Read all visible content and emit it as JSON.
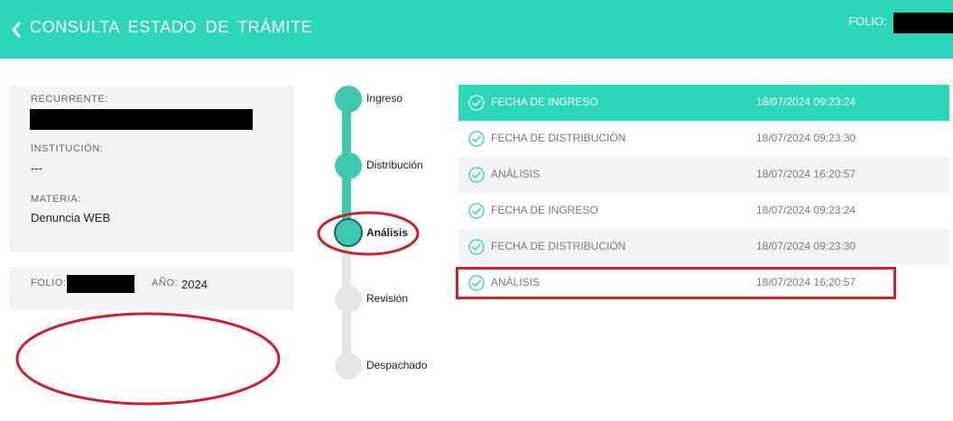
{
  "header": {
    "title": "CONSULTA ESTADO DE TRÁMITE",
    "folio_label": "FOLIO:",
    "bg_color": "#2bd6b9"
  },
  "info": {
    "recurrente_label": "RECURRENTE:",
    "institucion_label": "INSTITUCIÓN:",
    "institucion_value": "---",
    "materia_label": "MATERIA:",
    "materia_value": "Denuncia WEB"
  },
  "folio_card": {
    "folio_label": "FOLIO:",
    "anio_label": "AÑO:",
    "anio_value": "2024"
  },
  "timeline": {
    "stages": [
      {
        "label": "Ingreso",
        "state": "done"
      },
      {
        "label": "Distribución",
        "state": "done"
      },
      {
        "label": "Análisis",
        "state": "current"
      },
      {
        "label": "Revisión",
        "state": "pending"
      },
      {
        "label": "Despachado",
        "state": "pending"
      }
    ],
    "colors": {
      "done": "#3ec9ae",
      "pending": "#e6e6e6",
      "current_border": "#1e5f73"
    }
  },
  "history": {
    "rows": [
      {
        "label": "FECHA DE INGRESO",
        "date": "18/07/2024 09:23:24",
        "highlight": true
      },
      {
        "label": "FECHA DE DISTRIBUCIÓN",
        "date": "18/07/2024 09:23:30",
        "highlight": false
      },
      {
        "label": "ANÁLISIS",
        "date": "18/07/2024 16:20:57",
        "highlight": false
      },
      {
        "label": "FECHA DE INGRESO",
        "date": "18/07/2024 09:23:24",
        "highlight": false
      },
      {
        "label": "FECHA DE DISTRIBUCIÓN",
        "date": "18/07/2024 09:23:30",
        "highlight": false
      },
      {
        "label": "ANÁLISIS",
        "date": "18/07/2024 16:20:57",
        "highlight": false
      }
    ]
  },
  "annotation_color": "#cc2229"
}
